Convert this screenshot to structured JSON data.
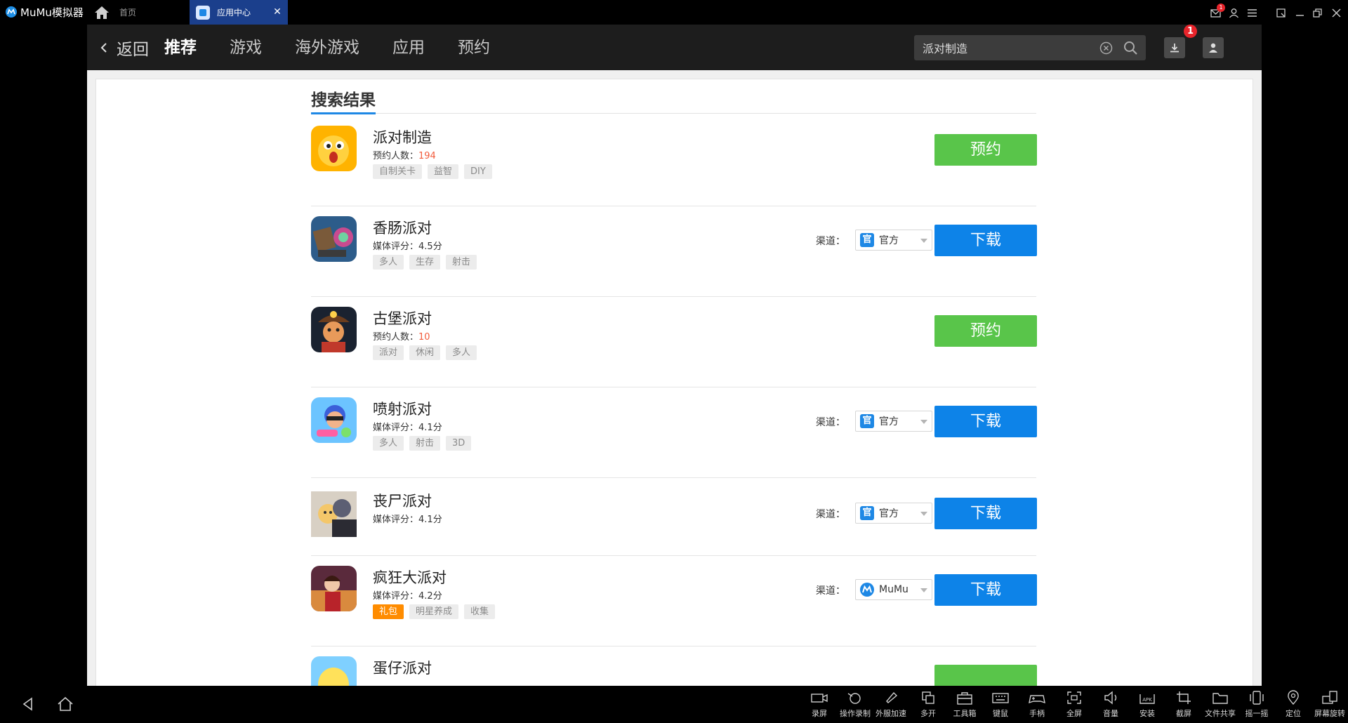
{
  "titlebar": {
    "app_name": "MuMu模拟器",
    "home_tab": "首页",
    "active_tab": "应用中心",
    "mail_badge": "1"
  },
  "nav": {
    "back": "返回",
    "items": [
      "推荐",
      "游戏",
      "海外游戏",
      "应用",
      "预约"
    ],
    "active": "推荐",
    "search_value": "派对制造",
    "download_badge": "1"
  },
  "results": {
    "heading": "搜索结果",
    "channel_label": "渠道：",
    "apps": [
      {
        "name": "派对制造",
        "meta_label": "预约人数：",
        "meta_value": "194",
        "tags": [
          "自制关卡",
          "益智",
          "DIY"
        ],
        "action": "预约",
        "icon": "party-maker-icon"
      },
      {
        "name": "香肠派对",
        "meta_label": "媒体评分：",
        "meta_value": "4.5分",
        "tags": [
          "多人",
          "生存",
          "射击"
        ],
        "channel": "官方",
        "action": "下载",
        "icon": "sausage-party-icon"
      },
      {
        "name": "古堡派对",
        "meta_label": "预约人数：",
        "meta_value": "10",
        "tags": [
          "派对",
          "休闲",
          "多人"
        ],
        "action": "预约",
        "icon": "castle-party-icon"
      },
      {
        "name": "喷射派对",
        "meta_label": "媒体评分：",
        "meta_value": "4.1分",
        "tags": [
          "多人",
          "射击",
          "3D"
        ],
        "channel": "官方",
        "action": "下载",
        "icon": "splash-party-icon"
      },
      {
        "name": "丧尸派对",
        "meta_label": "媒体评分：",
        "meta_value": "4.1分",
        "tags": [],
        "channel": "官方",
        "action": "下载",
        "icon": "zombie-party-icon"
      },
      {
        "name": "疯狂大派对",
        "meta_label": "媒体评分：",
        "meta_value": "4.2分",
        "tags": [
          "礼包",
          "明星养成",
          "收集"
        ],
        "channel": "MuMu",
        "action": "下载",
        "icon": "crazy-party-icon"
      },
      {
        "name": "蛋仔派对",
        "icon": "eggy-party-icon"
      }
    ]
  },
  "toolbar": {
    "items": [
      "录屏",
      "操作录制",
      "外服加速",
      "多开",
      "工具箱",
      "键鼠",
      "手柄",
      "全屏",
      "音量",
      "安装",
      "截屏",
      "文件共享",
      "摇一摇",
      "定位",
      "屏幕旋转"
    ]
  },
  "colors": {
    "accent": "#0d83e8",
    "reserve_green": "#59c54a",
    "tab_blue": "#1b3f8c",
    "badge_red": "#e8242b",
    "count_orange": "#f25c3c"
  }
}
